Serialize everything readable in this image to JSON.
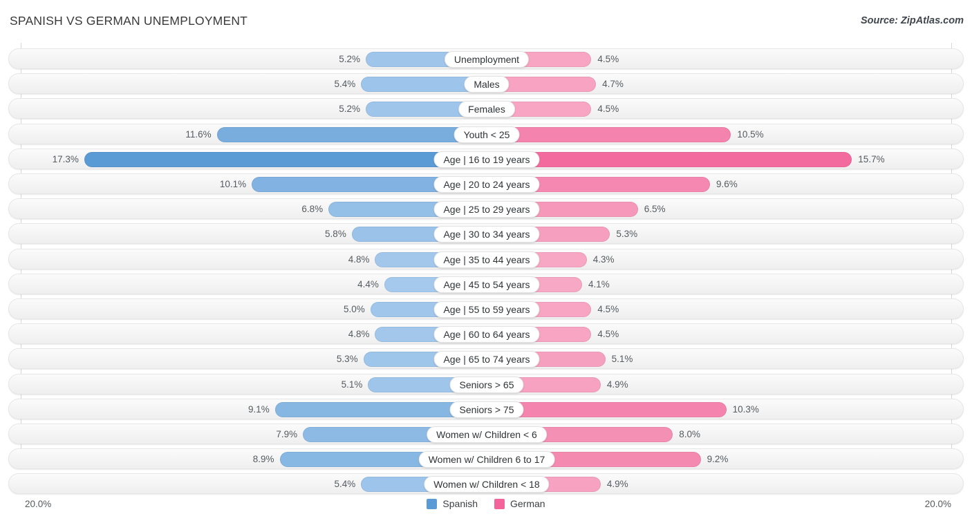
{
  "header": {
    "title": "SPANISH VS GERMAN UNEMPLOYMENT",
    "source": "Source: ZipAtlas.com"
  },
  "legend": {
    "items": [
      {
        "label": "Spanish",
        "color": "#5b9bd5"
      },
      {
        "label": "German",
        "color": "#f2649a"
      }
    ]
  },
  "axis": {
    "left_label": "20.0%",
    "right_label": "20.0%",
    "max": 20.0
  },
  "colors": {
    "spanish_light": "#a8cbed",
    "spanish_mid": "#8cb9e4",
    "spanish_dark": "#5b9bd5",
    "german_light": "#f7a8c4",
    "german_mid": "#f589ae",
    "german_dark": "#f2649a",
    "row_track": "#f4f4f4",
    "gridline": "#d7d7d7"
  },
  "chart_data": {
    "type": "bar",
    "title": "SPANISH VS GERMAN UNEMPLOYMENT",
    "subtitle": "",
    "xlabel": "",
    "ylabel": "",
    "orientation": "horizontal-diverging",
    "grid": true,
    "legend_position": "bottom-center",
    "xlim": [
      20.0,
      20.0
    ],
    "axis_tick_labels": [
      "20.0%",
      "20.0%"
    ],
    "categories": [
      "Unemployment",
      "Males",
      "Females",
      "Youth < 25",
      "Age | 16 to 19 years",
      "Age | 20 to 24 years",
      "Age | 25 to 29 years",
      "Age | 30 to 34 years",
      "Age | 35 to 44 years",
      "Age | 45 to 54 years",
      "Age | 55 to 59 years",
      "Age | 60 to 64 years",
      "Age | 65 to 74 years",
      "Seniors > 65",
      "Seniors > 75",
      "Women w/ Children < 6",
      "Women w/ Children 6 to 17",
      "Women w/ Children < 18"
    ],
    "series": [
      {
        "name": "Spanish",
        "side": "left",
        "color": "#5b9bd5",
        "values": [
          5.2,
          5.4,
          5.2,
          11.6,
          17.3,
          10.1,
          6.8,
          5.8,
          4.8,
          4.4,
          5.0,
          4.8,
          5.3,
          5.1,
          9.1,
          7.9,
          8.9,
          5.4
        ],
        "labels": [
          "5.2%",
          "5.4%",
          "5.2%",
          "11.6%",
          "17.3%",
          "10.1%",
          "6.8%",
          "5.8%",
          "4.8%",
          "4.4%",
          "5.0%",
          "4.8%",
          "5.3%",
          "5.1%",
          "9.1%",
          "7.9%",
          "8.9%",
          "5.4%"
        ]
      },
      {
        "name": "German",
        "side": "right",
        "color": "#f2649a",
        "values": [
          4.5,
          4.7,
          4.5,
          10.5,
          15.7,
          9.6,
          6.5,
          5.3,
          4.3,
          4.1,
          4.5,
          4.5,
          5.1,
          4.9,
          10.3,
          8.0,
          9.2,
          4.9
        ],
        "labels": [
          "4.5%",
          "4.7%",
          "4.5%",
          "10.5%",
          "15.7%",
          "9.6%",
          "6.5%",
          "5.3%",
          "4.3%",
          "4.1%",
          "4.5%",
          "4.5%",
          "5.1%",
          "4.9%",
          "10.3%",
          "8.0%",
          "9.2%",
          "4.9%"
        ]
      }
    ]
  }
}
